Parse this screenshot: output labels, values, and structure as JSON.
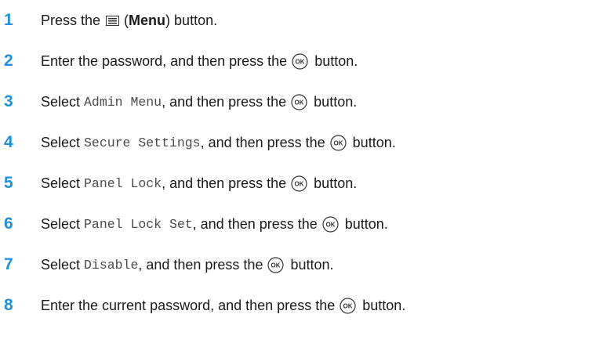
{
  "steps": [
    {
      "num": "1",
      "t1": "Press the",
      "t2": "(",
      "t3": "Menu",
      "t4": ") button.",
      "icon": "menu-icon"
    },
    {
      "num": "2",
      "t1": "Enter the password, and then press the",
      "t2": "button.",
      "icon": "ok-button-icon"
    },
    {
      "num": "3",
      "t1": "Select ",
      "code": "Admin Menu",
      "t2": ", and then press the",
      "t3": "button.",
      "icon": "ok-button-icon"
    },
    {
      "num": "4",
      "t1": "Select ",
      "code": "Secure Settings",
      "t2": ", and then press the",
      "t3": "button.",
      "icon": "ok-button-icon"
    },
    {
      "num": "5",
      "t1": "Select ",
      "code": "Panel Lock",
      "t2": ", and then press the",
      "t3": "button.",
      "icon": "ok-button-icon"
    },
    {
      "num": "6",
      "t1": "Select ",
      "code": "Panel Lock Set",
      "t2": ", and then press the",
      "t3": "button.",
      "icon": "ok-button-icon"
    },
    {
      "num": "7",
      "t1": "Select ",
      "code": "Disable",
      "t2": ", and then press the",
      "t3": "button.",
      "icon": "ok-button-icon"
    },
    {
      "num": "8",
      "t1": "Enter the current password, and then press the",
      "t2": "button.",
      "icon": "ok-button-icon"
    }
  ],
  "ok_icon_label": "OK",
  "colors": {
    "step_number": "#1a92e0",
    "text": "#1a1a1a",
    "code": "#4a4a4a"
  }
}
